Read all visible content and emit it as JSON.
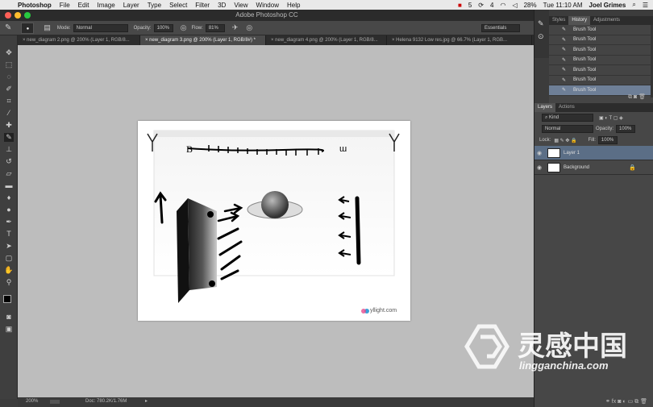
{
  "menubar": {
    "app_name": "Photoshop",
    "menus": [
      "File",
      "Edit",
      "Image",
      "Layer",
      "Type",
      "Select",
      "Filter",
      "3D",
      "View",
      "Window",
      "Help"
    ],
    "status": {
      "badge1": "5",
      "badge2": "4",
      "battery": "28%",
      "time": "Tue 11:10 AM",
      "user": "Joel Grimes"
    }
  },
  "window": {
    "title": "Adobe Photoshop CC"
  },
  "options": {
    "mode_label": "Mode:",
    "mode_value": "Normal",
    "opacity_label": "Opacity:",
    "opacity_value": "100%",
    "flow_label": "Flow:",
    "flow_value": "81%",
    "workspace": "Essentials",
    "brush_size": "3"
  },
  "tabs": [
    {
      "label": "new_diagram 2.png @ 200% (Layer 1, RGB/8..."
    },
    {
      "label": "new_diagram 3.png @ 200% (Layer 1, RGB/8#) *"
    },
    {
      "label": "new_diagram 4.png @ 200% (Layer 1, RGB/8..."
    },
    {
      "label": "Helena 9132 Low res.jpg @ 66.7% (Layer 1, RGB..."
    }
  ],
  "status_bar": {
    "zoom": "200%",
    "doc": "Doc: 780.2K/1.76M"
  },
  "history_panel": {
    "tabs": [
      "Styles",
      "History",
      "Adjustments"
    ],
    "items": [
      "Brush Tool",
      "Brush Tool",
      "Brush Tool",
      "Brush Tool",
      "Brush Tool",
      "Brush Tool",
      "Brush Tool"
    ]
  },
  "layers_panel": {
    "tabs": [
      "Layers",
      "Actions"
    ],
    "filter": "Kind",
    "blend_mode": "Normal",
    "opacity_label": "Opacity:",
    "opacity_value": "100%",
    "lock_label": "Lock:",
    "fill_label": "Fill:",
    "fill_value": "100%",
    "layers": [
      {
        "name": "Layer 1",
        "selected": true
      },
      {
        "name": "Background",
        "selected": false
      }
    ]
  },
  "document": {
    "logo_text": "yllight.com"
  },
  "watermark": {
    "cn": "灵感中国",
    "url": "lingganchina.com"
  },
  "colors": {
    "accent": "#5b6e86",
    "canvas_bg": "#bdbdbd"
  }
}
